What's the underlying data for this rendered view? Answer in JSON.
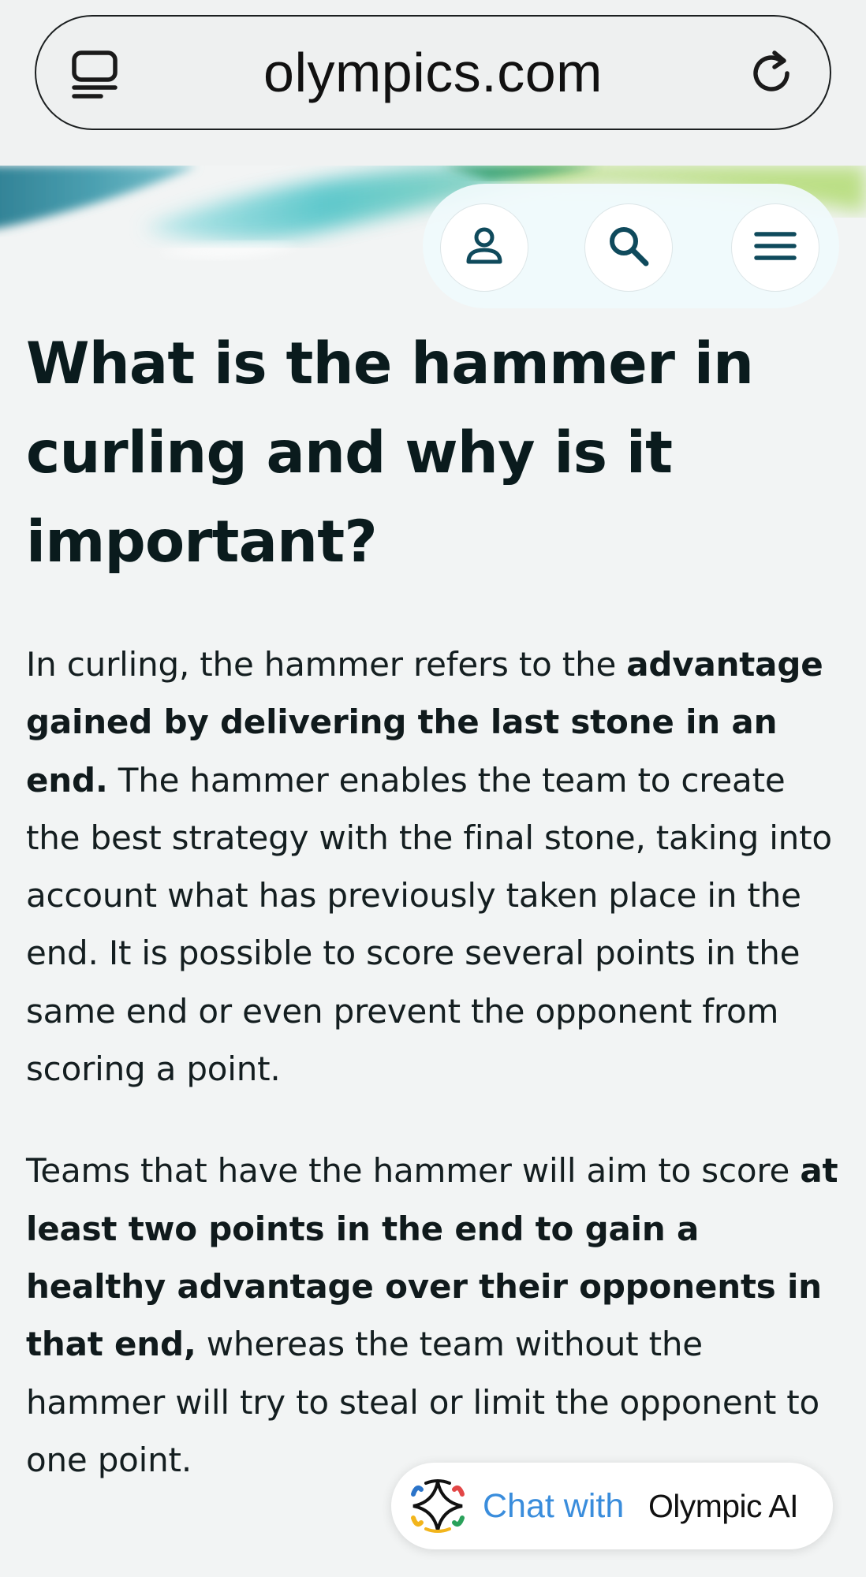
{
  "browser": {
    "url": "olympics.com",
    "tabs_icon": "tabs-icon",
    "reload_icon": "reload-icon"
  },
  "header": {
    "profile_icon": "profile-icon",
    "search_icon": "search-icon",
    "menu_icon": "menu-icon"
  },
  "article": {
    "title": "What is the hammer in curling and why is it important?",
    "p1": {
      "t1": "In curling, the hammer refers to the ",
      "b1": "advantage gained by delivering the last stone in an end.",
      "t2": " The hammer enables the team to create the best strategy with the final stone, taking into account what has previously taken place in the end. It is possible to score several points in the same end or even prevent the opponent from scoring a point."
    },
    "p2": {
      "t1": "Teams that have the hammer will aim to score ",
      "b1": "at least two points in the end to gain a healthy advantage over their opponents in that end,",
      "t2": " whereas the team without the hammer will try to steal or limit the opponent to one point."
    }
  },
  "chat": {
    "label": "Chat with",
    "brand": "Olympic AI",
    "icon": "olympic-ai-star-icon",
    "colors": {
      "label": "#3a8ddc"
    }
  }
}
